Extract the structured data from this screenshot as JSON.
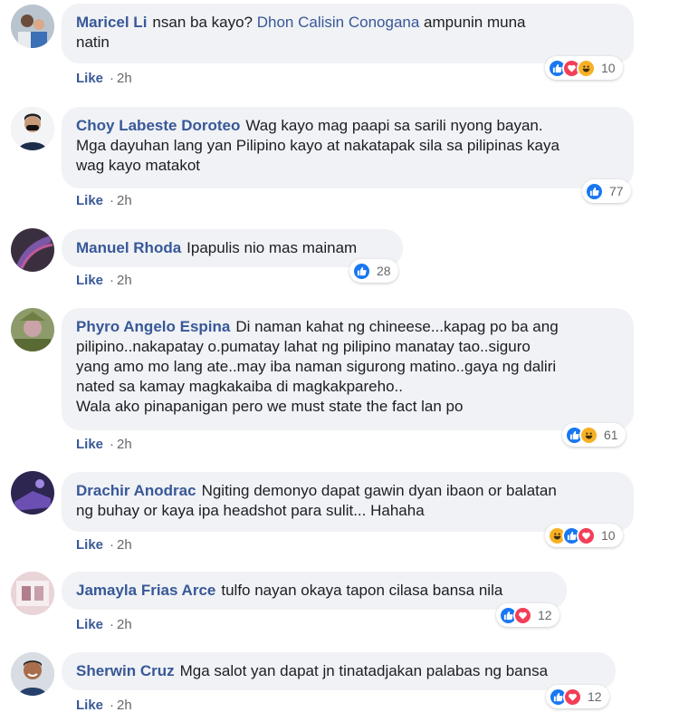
{
  "comments": [
    {
      "author": "Maricel Li",
      "text_before": "nsan ba kayo?",
      "mention": "Dhon Calisin Conogana",
      "text_after": "ampunin muna",
      "line2": "natin",
      "like_label": "Like",
      "time": "2h",
      "reaction_count": "10",
      "reactions": [
        "like",
        "love",
        "haha"
      ]
    },
    {
      "author": "Choy Labeste Doroteo",
      "text_line1": "Wag kayo mag paapi sa sarili nyong bayan.",
      "text_line2": "Mga dayuhan lang yan Pilipino kayo at nakatapak sila sa pilipinas kaya",
      "text_line3": "wag kayo matakot",
      "like_label": "Like",
      "time": "2h",
      "reaction_count": "77",
      "reactions": [
        "like"
      ]
    },
    {
      "author": "Manuel Rhoda",
      "text_line1": "Ipapulis nio mas mainam",
      "like_label": "Like",
      "time": "2h",
      "reaction_count": "28",
      "reactions": [
        "like"
      ]
    },
    {
      "author": "Phyro Angelo Espina",
      "text_line1": "Di naman kahat ng chineese...kapag po ba ang",
      "text_line2": "pilipino..nakapatay o.pumatay lahat ng pilipino manatay tao..siguro",
      "text_line3": "yang amo mo lang ate..may iba naman sigurong matino..gaya ng daliri",
      "text_line4": "nated sa kamay magkakaiba di magkakpareho..",
      "text_line5": "Wala ako pinapanigan pero we must state the fact lan po",
      "like_label": "Like",
      "time": "2h",
      "reaction_count": "61",
      "reactions": [
        "like",
        "haha"
      ]
    },
    {
      "author": "Drachir Anodrac",
      "text_line1": "Ngiting demonyo dapat gawin dyan ibaon or balatan",
      "text_line2": "ng buhay or kaya ipa headshot para sulit... Hahaha",
      "like_label": "Like",
      "time": "2h",
      "reaction_count": "10",
      "reactions": [
        "haha",
        "like",
        "love"
      ]
    },
    {
      "author": "Jamayla Frias Arce",
      "text_line1": "tulfo nayan okaya tapon cilasa bansa nila",
      "like_label": "Like",
      "time": "2h",
      "reaction_count": "12",
      "reactions": [
        "like",
        "love"
      ]
    },
    {
      "author": "Sherwin Cruz",
      "text_line1": "Mga salot yan dapat jn tinatadjakan palabas ng bansa",
      "like_label": "Like",
      "time": "2h",
      "reaction_count": "12",
      "reactions": [
        "like",
        "love"
      ]
    }
  ],
  "colors": {
    "author": "#385898",
    "bubble": "#f0f2f5",
    "like_reaction": "#1877f2",
    "love_reaction": "#f33e58",
    "haha_reaction": "#f7b125"
  }
}
